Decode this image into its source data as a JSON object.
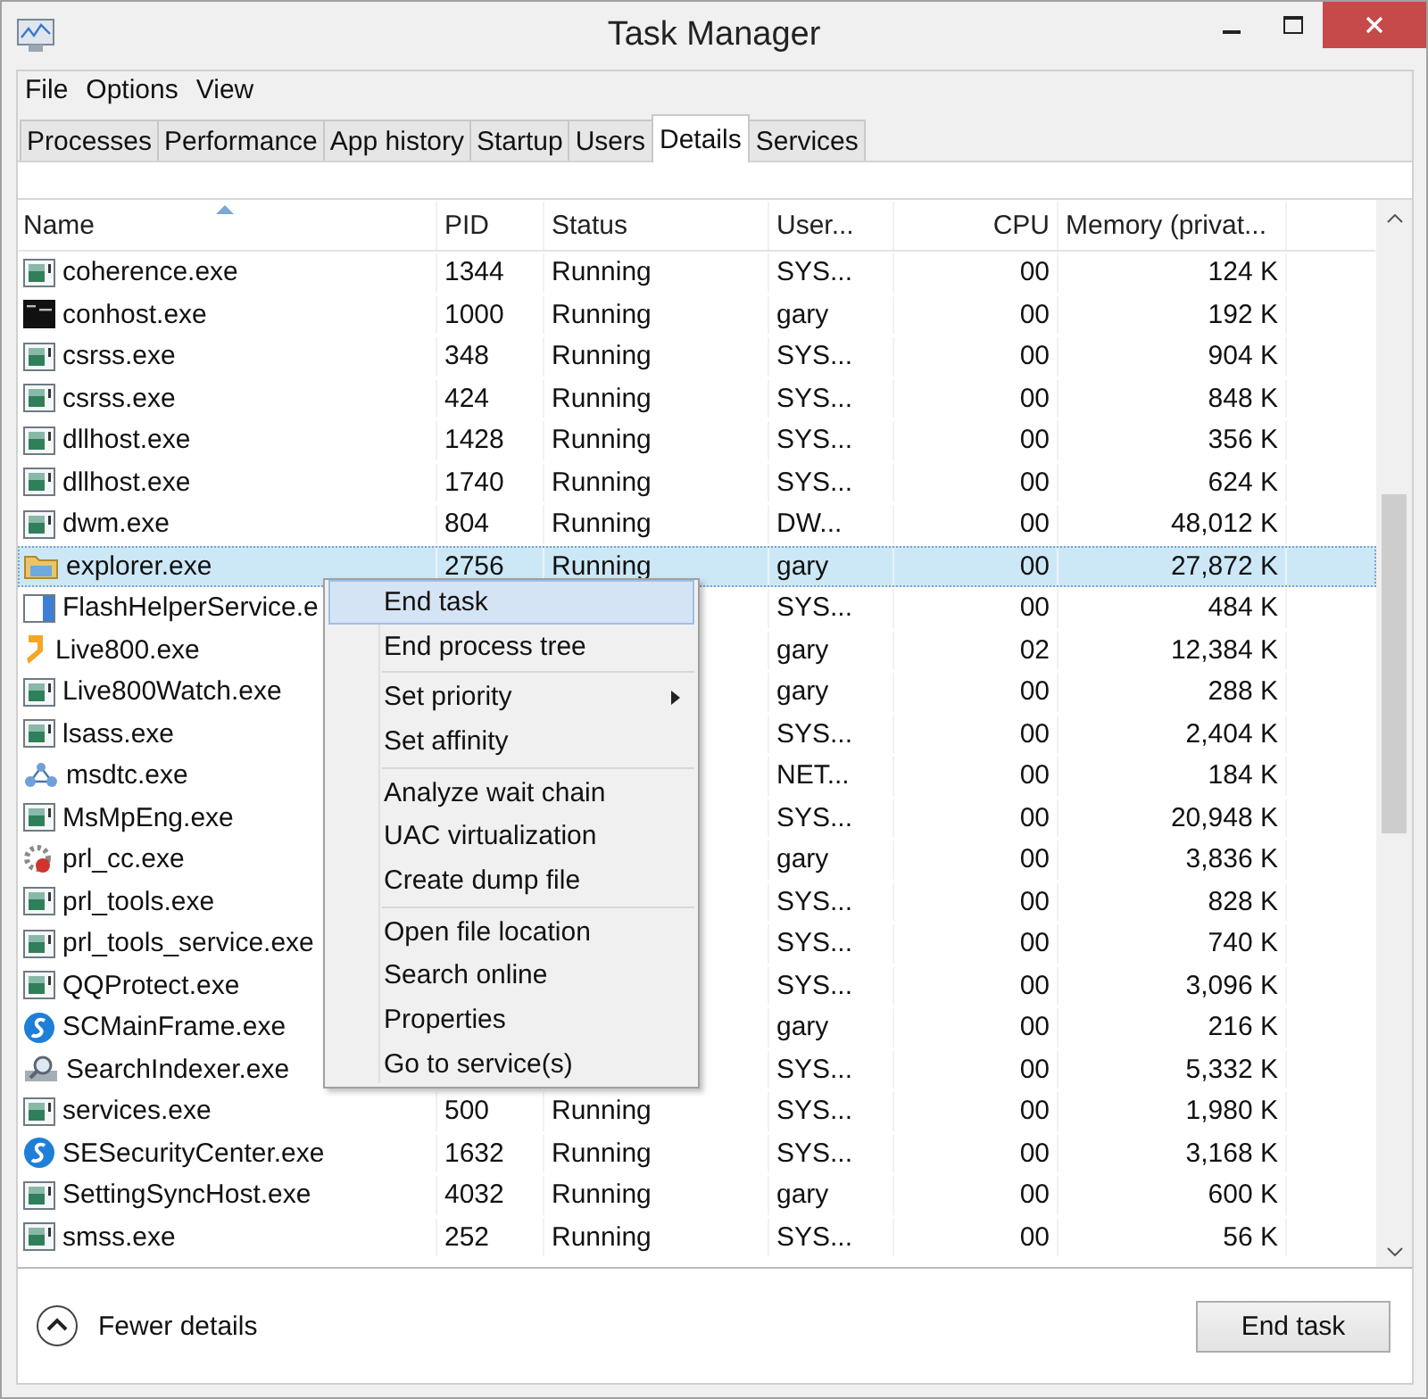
{
  "window": {
    "title": "Task Manager"
  },
  "menu_bar": [
    "File",
    "Options",
    "View"
  ],
  "tabs": [
    {
      "label": "Processes",
      "selected": false
    },
    {
      "label": "Performance",
      "selected": false
    },
    {
      "label": "App history",
      "selected": false
    },
    {
      "label": "Startup",
      "selected": false
    },
    {
      "label": "Users",
      "selected": false
    },
    {
      "label": "Details",
      "selected": true
    },
    {
      "label": "Services",
      "selected": false
    }
  ],
  "table": {
    "columns": [
      {
        "label": "Name",
        "sorted": true
      },
      {
        "label": "PID",
        "sorted": false
      },
      {
        "label": "Status",
        "sorted": false
      },
      {
        "label": "User...",
        "sorted": false
      },
      {
        "label": "CPU",
        "sorted": false
      },
      {
        "label": "Memory (privat...",
        "sorted": false
      }
    ],
    "rows": [
      {
        "kind": "app",
        "name": "coherence.exe",
        "pid": "1344",
        "status": "Running",
        "user": "SYS...",
        "cpu": "00",
        "memory": "124 K",
        "selected": false
      },
      {
        "kind": "console",
        "name": "conhost.exe",
        "pid": "1000",
        "status": "Running",
        "user": "gary",
        "cpu": "00",
        "memory": "192 K",
        "selected": false
      },
      {
        "kind": "app",
        "name": "csrss.exe",
        "pid": "348",
        "status": "Running",
        "user": "SYS...",
        "cpu": "00",
        "memory": "904 K",
        "selected": false
      },
      {
        "kind": "app",
        "name": "csrss.exe",
        "pid": "424",
        "status": "Running",
        "user": "SYS...",
        "cpu": "00",
        "memory": "848 K",
        "selected": false
      },
      {
        "kind": "app",
        "name": "dllhost.exe",
        "pid": "1428",
        "status": "Running",
        "user": "SYS...",
        "cpu": "00",
        "memory": "356 K",
        "selected": false
      },
      {
        "kind": "app",
        "name": "dllhost.exe",
        "pid": "1740",
        "status": "Running",
        "user": "SYS...",
        "cpu": "00",
        "memory": "624 K",
        "selected": false
      },
      {
        "kind": "app",
        "name": "dwm.exe",
        "pid": "804",
        "status": "Running",
        "user": "DW...",
        "cpu": "00",
        "memory": "48,012 K",
        "selected": false
      },
      {
        "kind": "folder",
        "name": "explorer.exe",
        "pid": "2756",
        "status": "Running",
        "user": "gary",
        "cpu": "00",
        "memory": "27,872 K",
        "selected": true
      },
      {
        "kind": "window",
        "name": "FlashHelperService.e",
        "user": "SYS...",
        "cpu": "00",
        "memory": "484 K",
        "selected": false
      },
      {
        "kind": "drop",
        "name": "Live800.exe",
        "user": "gary",
        "cpu": "02",
        "memory": "12,384 K",
        "selected": false
      },
      {
        "kind": "app",
        "name": "Live800Watch.exe",
        "user": "gary",
        "cpu": "00",
        "memory": "288 K",
        "selected": false
      },
      {
        "kind": "app",
        "name": "lsass.exe",
        "user": "SYS...",
        "cpu": "00",
        "memory": "2,404 K",
        "selected": false
      },
      {
        "kind": "network",
        "name": "msdtc.exe",
        "user": "NET...",
        "cpu": "00",
        "memory": "184 K",
        "selected": false
      },
      {
        "kind": "app",
        "name": "MsMpEng.exe",
        "user": "SYS...",
        "cpu": "00",
        "memory": "20,948 K",
        "selected": false
      },
      {
        "kind": "gear",
        "name": "prl_cc.exe",
        "user": "gary",
        "cpu": "00",
        "memory": "3,836 K",
        "selected": false
      },
      {
        "kind": "app",
        "name": "prl_tools.exe",
        "user": "SYS...",
        "cpu": "00",
        "memory": "828 K",
        "selected": false
      },
      {
        "kind": "app",
        "name": "prl_tools_service.exe",
        "user": "SYS...",
        "cpu": "00",
        "memory": "740 K",
        "selected": false
      },
      {
        "kind": "app",
        "name": "QQProtect.exe",
        "user": "SYS...",
        "cpu": "00",
        "memory": "3,096 K",
        "selected": false
      },
      {
        "kind": "s",
        "name": "SCMainFrame.exe",
        "user": "gary",
        "cpu": "00",
        "memory": "216 K",
        "selected": false
      },
      {
        "kind": "search",
        "name": "SearchIndexer.exe",
        "user": "SYS...",
        "cpu": "00",
        "memory": "5,332 K",
        "selected": false
      },
      {
        "kind": "app",
        "name": "services.exe",
        "pid": "500",
        "status": "Running",
        "user": "SYS...",
        "cpu": "00",
        "memory": "1,980 K",
        "selected": false
      },
      {
        "kind": "s",
        "name": "SESecurityCenter.exe",
        "pid": "1632",
        "status": "Running",
        "user": "SYS...",
        "cpu": "00",
        "memory": "3,168 K",
        "selected": false
      },
      {
        "kind": "app",
        "name": "SettingSyncHost.exe",
        "pid": "4032",
        "status": "Running",
        "user": "gary",
        "cpu": "00",
        "memory": "600 K",
        "selected": false
      },
      {
        "kind": "app",
        "name": "smss.exe",
        "pid": "252",
        "status": "Running",
        "user": "SYS...",
        "cpu": "00",
        "memory": "56 K",
        "selected": false
      }
    ]
  },
  "context_menu": {
    "groups": [
      [
        {
          "label": "End task",
          "highlighted": true,
          "submenu": false
        },
        {
          "label": "End process tree",
          "highlighted": false,
          "submenu": false
        }
      ],
      [
        {
          "label": "Set priority",
          "highlighted": false,
          "submenu": true
        },
        {
          "label": "Set affinity",
          "highlighted": false,
          "submenu": false
        }
      ],
      [
        {
          "label": "Analyze wait chain",
          "highlighted": false,
          "submenu": false
        },
        {
          "label": "UAC virtualization",
          "highlighted": false,
          "submenu": false
        },
        {
          "label": "Create dump file",
          "highlighted": false,
          "submenu": false
        }
      ],
      [
        {
          "label": "Open file location",
          "highlighted": false,
          "submenu": false
        },
        {
          "label": "Search online",
          "highlighted": false,
          "submenu": false
        },
        {
          "label": "Properties",
          "highlighted": false,
          "submenu": false
        },
        {
          "label": "Go to service(s)",
          "highlighted": false,
          "submenu": false
        }
      ]
    ]
  },
  "footer": {
    "toggle": "Fewer details",
    "button": "End task"
  }
}
